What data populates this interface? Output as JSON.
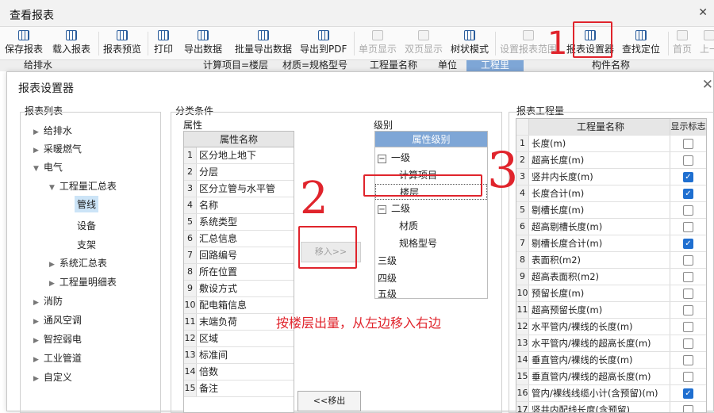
{
  "window": {
    "title": "查看报表"
  },
  "toolbar": [
    {
      "label": "保存报表",
      "disabled": false
    },
    {
      "label": "载入报表",
      "disabled": false
    },
    {
      "label": "报表预览",
      "disabled": false
    },
    {
      "label": "打印",
      "disabled": false
    },
    {
      "label": "导出数据",
      "disabled": false
    },
    {
      "label": "批量导出数据",
      "disabled": false
    },
    {
      "label": "导出到PDF",
      "disabled": false
    },
    {
      "label": "单页显示",
      "disabled": true
    },
    {
      "label": "双页显示",
      "disabled": true
    },
    {
      "label": "树状模式",
      "disabled": false
    },
    {
      "label": "设置报表范围",
      "disabled": true
    },
    {
      "label": "报表设置器",
      "disabled": false
    },
    {
      "label": "查找定位",
      "disabled": false
    },
    {
      "label": "首页",
      "disabled": true
    },
    {
      "label": "上一",
      "disabled": true
    }
  ],
  "grid_header": [
    "给排水",
    "计算项目=楼层",
    "材质=规格型号",
    "工程量名称",
    "单位",
    "工程里",
    "构件名称"
  ],
  "dialog": {
    "title": "报表设置器",
    "report_list_label": "报表列表",
    "condition_label": "分类条件",
    "attr_label": "属性",
    "level_label": "级别",
    "quantity_label": "报表工程量",
    "tree": [
      "给排水",
      "采暖燃气",
      "电气",
      "工程量汇总表",
      "管线",
      "设备",
      "支架",
      "系统汇总表",
      "工程量明细表",
      "消防",
      "通风空调",
      "智控弱电",
      "工业管道",
      "自定义"
    ],
    "attr_header": "属性名称",
    "attributes": [
      "区分地上地下",
      "分层",
      "区分立管与水平管",
      "名称",
      "系统类型",
      "汇总信息",
      "回路编号",
      "所在位置",
      "敷设方式",
      "配电箱信息",
      "末端负荷",
      "区域",
      "标准间",
      "倍数",
      "备注"
    ],
    "level_header": "属性级别",
    "levels": {
      "l1": "一级",
      "l1a": "计算项目",
      "l1b": "楼层",
      "l2": "二级",
      "l2a": "材质",
      "l2b": "规格型号",
      "l3": "三级",
      "l4": "四级",
      "l5": "五级"
    },
    "move_in": "移入>>",
    "move_out": "<<移出",
    "qty_header": "工程量名称",
    "qty_flag_header": "显示标志",
    "quantities": [
      {
        "name": "长度(m)",
        "checked": false
      },
      {
        "name": "超高长度(m)",
        "checked": false
      },
      {
        "name": "竖井内长度(m)",
        "checked": true
      },
      {
        "name": "长度合计(m)",
        "checked": true
      },
      {
        "name": "剔槽长度(m)",
        "checked": false
      },
      {
        "name": "超高剔槽长度(m)",
        "checked": false
      },
      {
        "name": "剔槽长度合计(m)",
        "checked": true
      },
      {
        "name": "表面积(m2)",
        "checked": false
      },
      {
        "name": "超高表面积(m2)",
        "checked": false
      },
      {
        "name": "预留长度(m)",
        "checked": false
      },
      {
        "name": "超高预留长度(m)",
        "checked": false
      },
      {
        "name": "水平管内/裸线的长度(m)",
        "checked": false
      },
      {
        "name": "水平管内/裸线的超高长度(m)",
        "checked": false
      },
      {
        "name": "垂直管内/裸线的长度(m)",
        "checked": false
      },
      {
        "name": "垂直管内/裸线的超高长度(m)",
        "checked": false
      },
      {
        "name": "管内/裸线线缆小计(含预留)(m)",
        "checked": true
      },
      {
        "name": "竖井内配线长度(含预留)",
        "checked": false
      }
    ]
  },
  "annotations": {
    "n1": "1",
    "n2": "2",
    "n3": "3",
    "note": "按楼层出量，从左边移入右边"
  }
}
